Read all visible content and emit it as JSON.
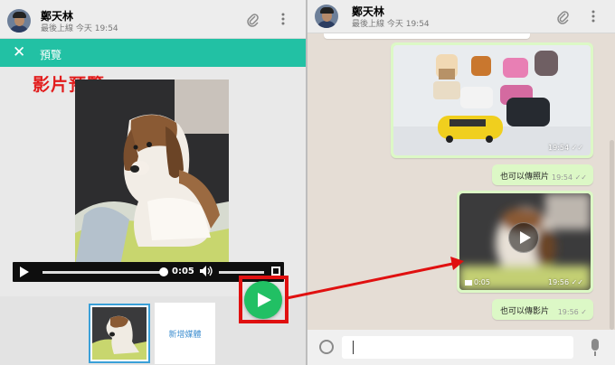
{
  "left_pane": {
    "contact": {
      "name": "鄭天林",
      "status": "最後上線 今天 19:54"
    },
    "icons": {
      "attach": "paperclip-icon",
      "menu": "more-vertical-icon"
    },
    "preview_bar": {
      "close_glyph": "✕",
      "title": "預覽"
    },
    "caption": "影片預覽",
    "video_player": {
      "time": "0:05",
      "progress": 0.98
    },
    "add_media_label": "新增媒體"
  },
  "right_pane": {
    "contact": {
      "name": "鄭天林",
      "status": "最後上線 今天 19:54"
    },
    "messages": [
      {
        "type": "photo",
        "time": "19:54 ✓✓"
      },
      {
        "type": "text",
        "text": "也可以傳照片",
        "time": "19:54 ✓✓"
      },
      {
        "type": "video",
        "duration": "0:05",
        "time": "19:56 ✓✓"
      },
      {
        "type": "text",
        "text": "也可以傳影片",
        "time": "19:56 ✓"
      }
    ],
    "input_placeholder": ""
  },
  "colors": {
    "accent": "#22c1a4",
    "send_button": "#21c064",
    "highlight": "#e01010",
    "bubble_out": "#dcf8c6",
    "chat_bg": "#e5ddd5"
  }
}
